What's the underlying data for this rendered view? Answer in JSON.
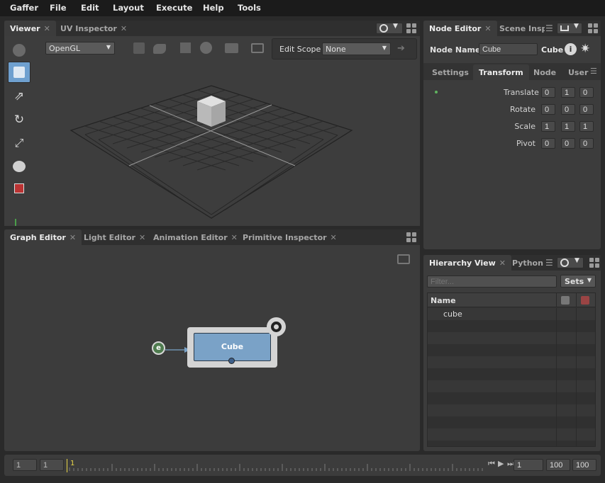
{
  "menu": [
    "Gaffer",
    "File",
    "Edit",
    "Layout",
    "Execute",
    "Help",
    "Tools"
  ],
  "viewer": {
    "tabs": [
      "Viewer",
      "UV Inspector"
    ],
    "renderer": "OpenGL",
    "edit_scope_label": "Edit Scope",
    "edit_scope_value": "None"
  },
  "node_editor": {
    "tabs": [
      "Node Editor",
      "Scene Inspector"
    ],
    "node_name_label": "Node Name",
    "node_name_value": "Cube",
    "node_type": "Cube",
    "subtabs": [
      "Settings",
      "Transform",
      "Node",
      "User"
    ],
    "active_subtab": "Transform",
    "rows": [
      {
        "label": "Translate",
        "values": [
          "0",
          "1",
          "0"
        ]
      },
      {
        "label": "Rotate",
        "values": [
          "0",
          "0",
          "0"
        ]
      },
      {
        "label": "Scale",
        "values": [
          "1",
          "1",
          "1"
        ]
      },
      {
        "label": "Pivot",
        "values": [
          "0",
          "0",
          "0"
        ]
      }
    ]
  },
  "graph_editor": {
    "tabs": [
      "Graph Editor",
      "Light Editor",
      "Animation Editor",
      "Primitive Inspector"
    ],
    "node_label": "Cube",
    "input_dot_label": "e"
  },
  "hierarchy": {
    "tabs": [
      "Hierarchy View",
      "Python"
    ],
    "filter_placeholder": "Filter...",
    "sets_label": "Sets",
    "column_name": "Name",
    "items": [
      "cube"
    ]
  },
  "timeline": {
    "start": "1",
    "start2": "1",
    "current_marker": "1",
    "current": "1",
    "end": "100",
    "end2": "100"
  },
  "colors": {
    "accent_blue": "#7aa2c7",
    "play_marker": "#e8d548",
    "status_green": "#5fb35f"
  }
}
